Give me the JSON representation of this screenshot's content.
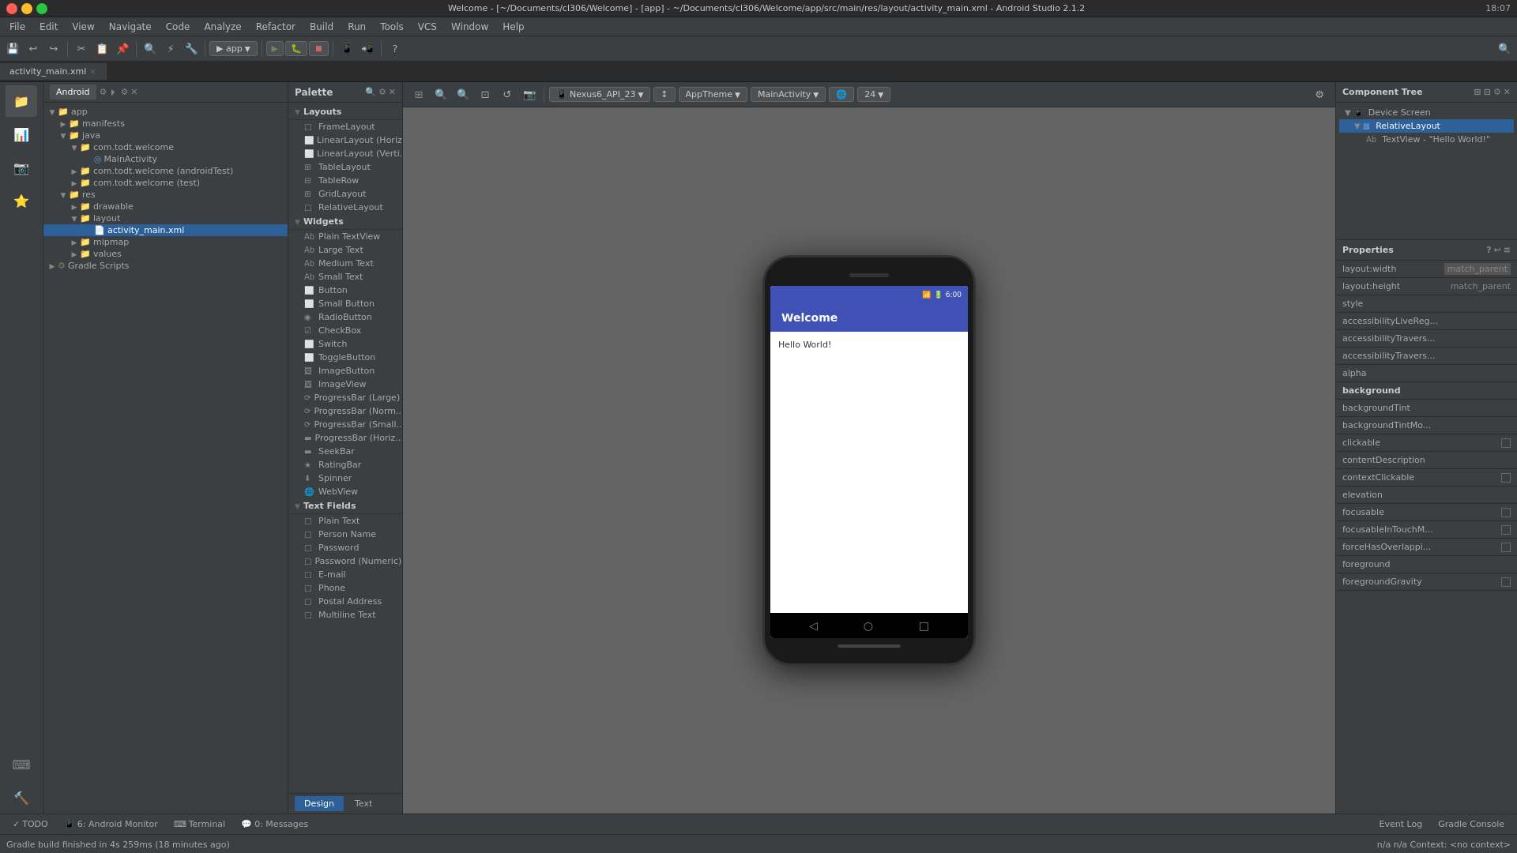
{
  "titlebar": {
    "title": "Welcome - [~/Documents/cl306/Welcome] - [app] - ~/Documents/cl306/Welcome/app/src/main/res/layout/activity_main.xml - Android Studio 2.1.2",
    "time": "18:07"
  },
  "menubar": {
    "items": [
      "File",
      "Edit",
      "View",
      "Navigate",
      "Code",
      "Analyze",
      "Refactor",
      "Build",
      "Run",
      "Tools",
      "VCS",
      "Window",
      "Help"
    ]
  },
  "breadcrumb": {
    "items": [
      "Welcome",
      "app",
      "src",
      "main",
      "res",
      "layout",
      "activity_main.xml"
    ]
  },
  "xml_tabs": {
    "tabs": [
      "activity_main.xml"
    ]
  },
  "palette": {
    "title": "Palette",
    "categories": {
      "layouts": {
        "label": "Layouts",
        "items": [
          "FrameLayout",
          "LinearLayout (Horiz...",
          "LinearLayout (Verti...",
          "TableLayout",
          "TableRow",
          "GridLayout",
          "RelativeLayout"
        ]
      },
      "widgets": {
        "label": "Widgets",
        "items": [
          "Plain TextView",
          "Large Text",
          "Medium Text",
          "Small Text",
          "Button",
          "Small Button",
          "RadioButton",
          "CheckBox",
          "Switch",
          "ToggleButton",
          "ImageButton",
          "ImageView",
          "ProgressBar (Large)",
          "ProgressBar (Norm...)",
          "ProgressBar (Small...)",
          "ProgressBar (Horiz...)",
          "SeekBar",
          "RatingBar",
          "Spinner",
          "WebView"
        ]
      },
      "text_fields": {
        "label": "Text Fields",
        "items": [
          "Plain Text",
          "Person Name",
          "Password",
          "Password (Numeric)",
          "E-mail",
          "Phone",
          "Postal Address",
          "Multiline Text"
        ]
      }
    }
  },
  "project_tree": {
    "items": [
      {
        "label": "app",
        "level": 0,
        "type": "folder",
        "expanded": true
      },
      {
        "label": "manifests",
        "level": 1,
        "type": "folder",
        "expanded": true
      },
      {
        "label": "java",
        "level": 1,
        "type": "folder",
        "expanded": true
      },
      {
        "label": "com.todt.welcome",
        "level": 2,
        "type": "folder",
        "expanded": true
      },
      {
        "label": "MainActivity",
        "level": 3,
        "type": "activity"
      },
      {
        "label": "com.todt.welcome (androidTest)",
        "level": 2,
        "type": "folder"
      },
      {
        "label": "com.todt.welcome (test)",
        "level": 2,
        "type": "folder"
      },
      {
        "label": "res",
        "level": 1,
        "type": "folder",
        "expanded": true
      },
      {
        "label": "drawable",
        "level": 2,
        "type": "folder"
      },
      {
        "label": "layout",
        "level": 2,
        "type": "folder",
        "expanded": true
      },
      {
        "label": "activity_main.xml",
        "level": 3,
        "type": "xml",
        "selected": true
      },
      {
        "label": "mipmap",
        "level": 2,
        "type": "folder"
      },
      {
        "label": "values",
        "level": 2,
        "type": "folder"
      },
      {
        "label": "Gradle Scripts",
        "level": 0,
        "type": "gradle"
      }
    ]
  },
  "phone": {
    "app_name": "Welcome",
    "content": "Hello World!",
    "time": "6:00"
  },
  "component_tree": {
    "title": "Component Tree",
    "items": [
      {
        "label": "Device Screen",
        "level": 0,
        "icon": "📱"
      },
      {
        "label": "RelativeLayout",
        "level": 1,
        "icon": "▦",
        "selected": true
      },
      {
        "label": "TextView - \"Hello World!\"",
        "level": 2,
        "icon": "Ab"
      }
    ]
  },
  "properties": {
    "title": "Properties",
    "items": [
      {
        "name": "layout:width",
        "value": "match_parent",
        "highlighted": true
      },
      {
        "name": "layout:height",
        "value": "match_parent"
      },
      {
        "name": "style",
        "value": ""
      },
      {
        "name": "accessibilityLiveReg...",
        "value": ""
      },
      {
        "name": "accessibilityTravers...",
        "value": ""
      },
      {
        "name": "accessibilityTravers...",
        "value": ""
      },
      {
        "name": "alpha",
        "value": ""
      },
      {
        "name": "background",
        "value": "",
        "bold": true
      },
      {
        "name": "backgroundTint",
        "value": ""
      },
      {
        "name": "backgroundTintMo...",
        "value": ""
      },
      {
        "name": "clickable",
        "value": "",
        "checkbox": true
      },
      {
        "name": "contentDescription",
        "value": ""
      },
      {
        "name": "contextClickable",
        "value": "",
        "checkbox": true
      },
      {
        "name": "elevation",
        "value": ""
      },
      {
        "name": "focusable",
        "value": "",
        "checkbox": true
      },
      {
        "name": "focusableInTouchM...",
        "value": "",
        "checkbox": true
      },
      {
        "name": "forceHasOverlappi...",
        "value": "",
        "checkbox": true
      },
      {
        "name": "foreground",
        "value": ""
      },
      {
        "name": "foregroundGravity",
        "value": "",
        "checkbox": true
      }
    ]
  },
  "design_toolbar": {
    "device": "Nexus6_API_23",
    "theme": "AppTheme",
    "activity": "MainActivity",
    "api": "24"
  },
  "bottom_tabs": {
    "tabs": [
      "TODO",
      "6: Android Monitor",
      "Terminal",
      "0: Messages"
    ]
  },
  "status_bar": {
    "message": "Gradle build finished in 4s 259ms (18 minutes ago)",
    "right": [
      "Event Log",
      "Gradle Console"
    ]
  },
  "design_tabs": {
    "tabs": [
      "Design",
      "Text"
    ],
    "active": "Design"
  },
  "sidebar_icons": [
    "project",
    "structure",
    "captures",
    "favorites",
    "build-variants",
    "android-model"
  ],
  "panel_header_tabs": [
    "Android"
  ]
}
